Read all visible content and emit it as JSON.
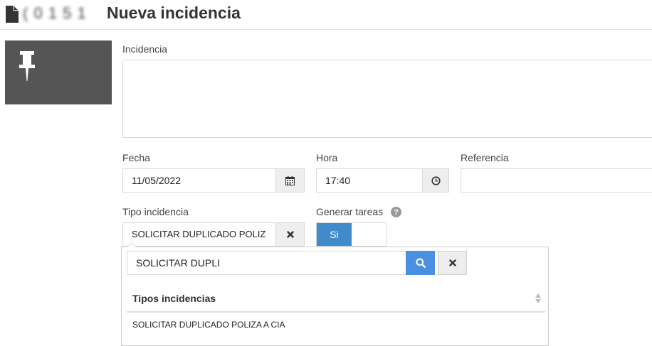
{
  "header": {
    "title": "Nueva incidencia",
    "ref_code": "( 0 1 5 1"
  },
  "form": {
    "incidencia_label": "Incidencia",
    "incidencia_value": "",
    "fecha_label": "Fecha",
    "fecha_value": "11/05/2022",
    "hora_label": "Hora",
    "hora_value": "17:40",
    "referencia_label": "Referencia",
    "referencia_value": "",
    "tipo_label": "Tipo incidencia",
    "tipo_value": "SOLICITAR DUPLICADO POLIZ",
    "generar_label": "Generar tareas",
    "help_glyph": "?",
    "toggle_label": "Si"
  },
  "dropdown": {
    "search_value": "SOLICITAR DUPLI",
    "list_header": "Tipos incidencias",
    "items": [
      "SOLICITAR DUPLICADO POLIZA A CIA"
    ]
  },
  "colors": {
    "accent": "#428bca",
    "search_button": "#4a90e2",
    "pin_panel": "#555555"
  }
}
